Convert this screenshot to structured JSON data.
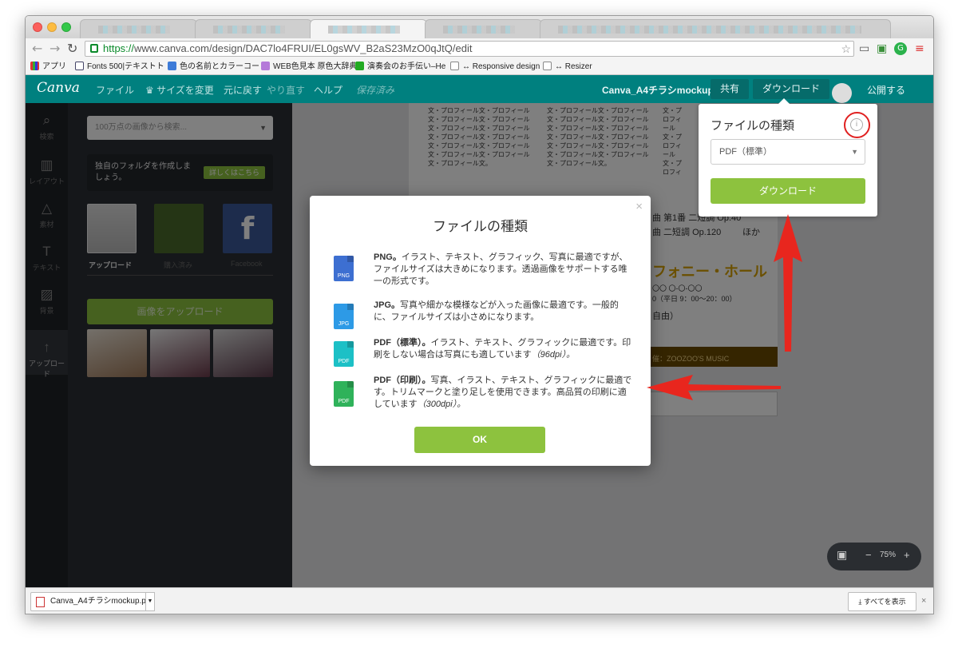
{
  "browser": {
    "url_scheme": "https://",
    "url_rest": "www.canva.com/design/DAC7lo4FRUI/EL0gsWV_B2aS23MzO0qJtQ/edit",
    "bookmarks": [
      "アプリ",
      "Fonts 500|テキストト",
      "色の名前とカラーコー",
      "WEB色見本 原色大辞典",
      "演奏会のお手伝い–He",
      "↔ Responsive design",
      "↔ Resizer"
    ]
  },
  "canva_nav": {
    "logo": "Canva",
    "file": "ファイル",
    "resize": "♛ サイズを変更",
    "undo": "元に戻す",
    "redo": "やり直す",
    "help": "ヘルプ",
    "saved": "保存済み",
    "design_name": "Canva_A4チラシmockup",
    "share": "共有",
    "download": "ダウンロード",
    "publish": "公開する"
  },
  "rail": [
    "検索",
    "レイアウト",
    "素材",
    "テキスト",
    "背景",
    "アップロード"
  ],
  "panel": {
    "search_placeholder": "100万点の画像から検索...",
    "folder_text": "独自のフォルダを作成しましょう。",
    "folder_btn": "詳しくはこちら",
    "tabs": [
      "アップロード",
      "購入済み",
      "Facebook"
    ],
    "upload_btn": "画像をアップロード"
  },
  "doc": {
    "col_text": "文・プロフィール文・プロフィール文・プロフィール文・プロフィール文・プロフィール文・プロフィール文・プロフィール文・プロフィール文・プロフィール文・プロフィール文・プロフィール文・プロフィール文・プロフィール文。",
    "line1": "曲 第1番 二短調 Op.40",
    "line2": "曲 二短調 Op.120",
    "line3": "ほか",
    "hall": "フォニー・ホール",
    "addr": "〇〇 〇-〇-〇〇",
    "hours": "0（平日 9：00〜20：00）",
    "free": "自由）",
    "sponsor": "催：ZOOZOO'S MUSIC"
  },
  "zoom": {
    "minus": "−",
    "level": "75%",
    "plus": "+"
  },
  "download_popover": {
    "title": "ファイルの種類",
    "info": "i",
    "selected": "PDF（標準）",
    "button": "ダウンロード"
  },
  "modal": {
    "close": "×",
    "title": "ファイルの種類",
    "items": [
      {
        "badge": "PNG",
        "color": "#3d6fd1",
        "name": "PNG。",
        "desc": "イラスト、テキスト、グラフィック、写真に最適ですが、ファイルサイズは大きめになります。透過画像をサポートする唯一の形式です。",
        "em": ""
      },
      {
        "badge": "JPG",
        "color": "#2d9ae6",
        "name": "JPG。",
        "desc": "写真や細かな模様などが入った画像に最適です。一般的に、ファイルサイズは小さめになります。",
        "em": ""
      },
      {
        "badge": "PDF",
        "color": "#1cc0c6",
        "name": "PDF（標準）。",
        "desc": "イラスト、テキスト、グラフィックに最適です。印刷をしない場合は写真にも適しています",
        "em": "（96dpi）。"
      },
      {
        "badge": "PDF",
        "color": "#2fb25a",
        "name": "PDF（印刷）。",
        "desc": "写真、イラスト、テキスト、グラフィックに最適です。トリムマークと塗り足しを使用できます。高品質の印刷に適しています",
        "em": "（300dpi）。"
      }
    ],
    "ok": "OK"
  },
  "download_bar": {
    "file": "Canva_A4チラシmockup.pdf",
    "show_all": "すべてを表示",
    "close": "×"
  }
}
